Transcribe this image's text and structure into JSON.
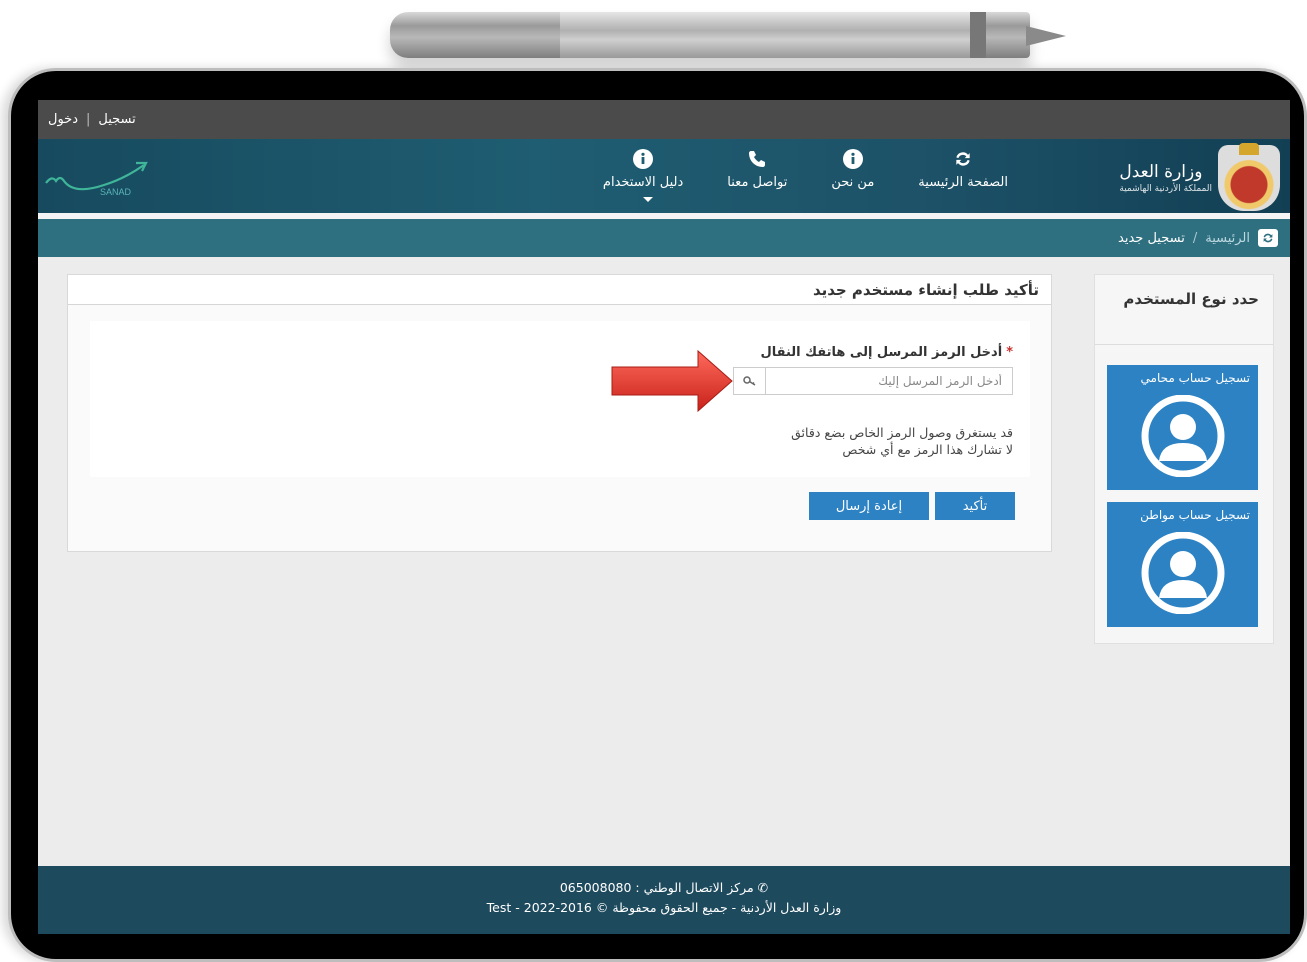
{
  "topbar": {
    "login": "دخول",
    "separator": "|",
    "register": "تسجيل"
  },
  "header": {
    "logo_title": "وزارة العدل",
    "logo_subtitle": "المملكة الأردنية الهاشمية",
    "sanad_label": "SANAD",
    "nav": [
      {
        "label": "الصفحة الرئيسية",
        "icon": "refresh-icon"
      },
      {
        "label": "من نحن",
        "icon": "info-icon"
      },
      {
        "label": "تواصل معنا",
        "icon": "phone-icon"
      },
      {
        "label": "دليل الاستخدام",
        "icon": "info-icon"
      }
    ]
  },
  "breadcrumb": {
    "home": "الرئيسية",
    "separator": "/",
    "current": "تسجيل جديد"
  },
  "sidebar": {
    "title": "حدد نوع المستخدم",
    "cards": [
      {
        "label": "تسجيل حساب محامي",
        "icon": "user-avatar-icon"
      },
      {
        "label": "تسجيل حساب مواطن",
        "icon": "user-avatar-icon"
      }
    ]
  },
  "panel": {
    "title": "تأكيد طلب إنشاء مستخدم جديد",
    "field_label": "أدخل الرمز المرسل إلى هاتفك النقال",
    "required_mark": "*",
    "input_placeholder": "أدخل الرمز المرسل إليك",
    "input_value": "",
    "hint_line1": "قد يستغرق وصول الرمز الخاص بضع دقائق",
    "hint_line2": "لا تشارك هذا الرمز مع أي شخص",
    "confirm_button": "تأكيد",
    "resend_button": "إعادة إرسال"
  },
  "footer": {
    "line1": "مركز الاتصال الوطني : 065008080",
    "line2": "وزارة العدل الأردنية - جميع الحقوق محفوظة © 2016-2022 - Test"
  },
  "colors": {
    "header_bg": "#1f5d72",
    "breadcrumb_bg": "#2e6f80",
    "primary_button": "#2d82c4",
    "footer_bg": "#1e4a5e",
    "arrow": "#e8423c"
  }
}
